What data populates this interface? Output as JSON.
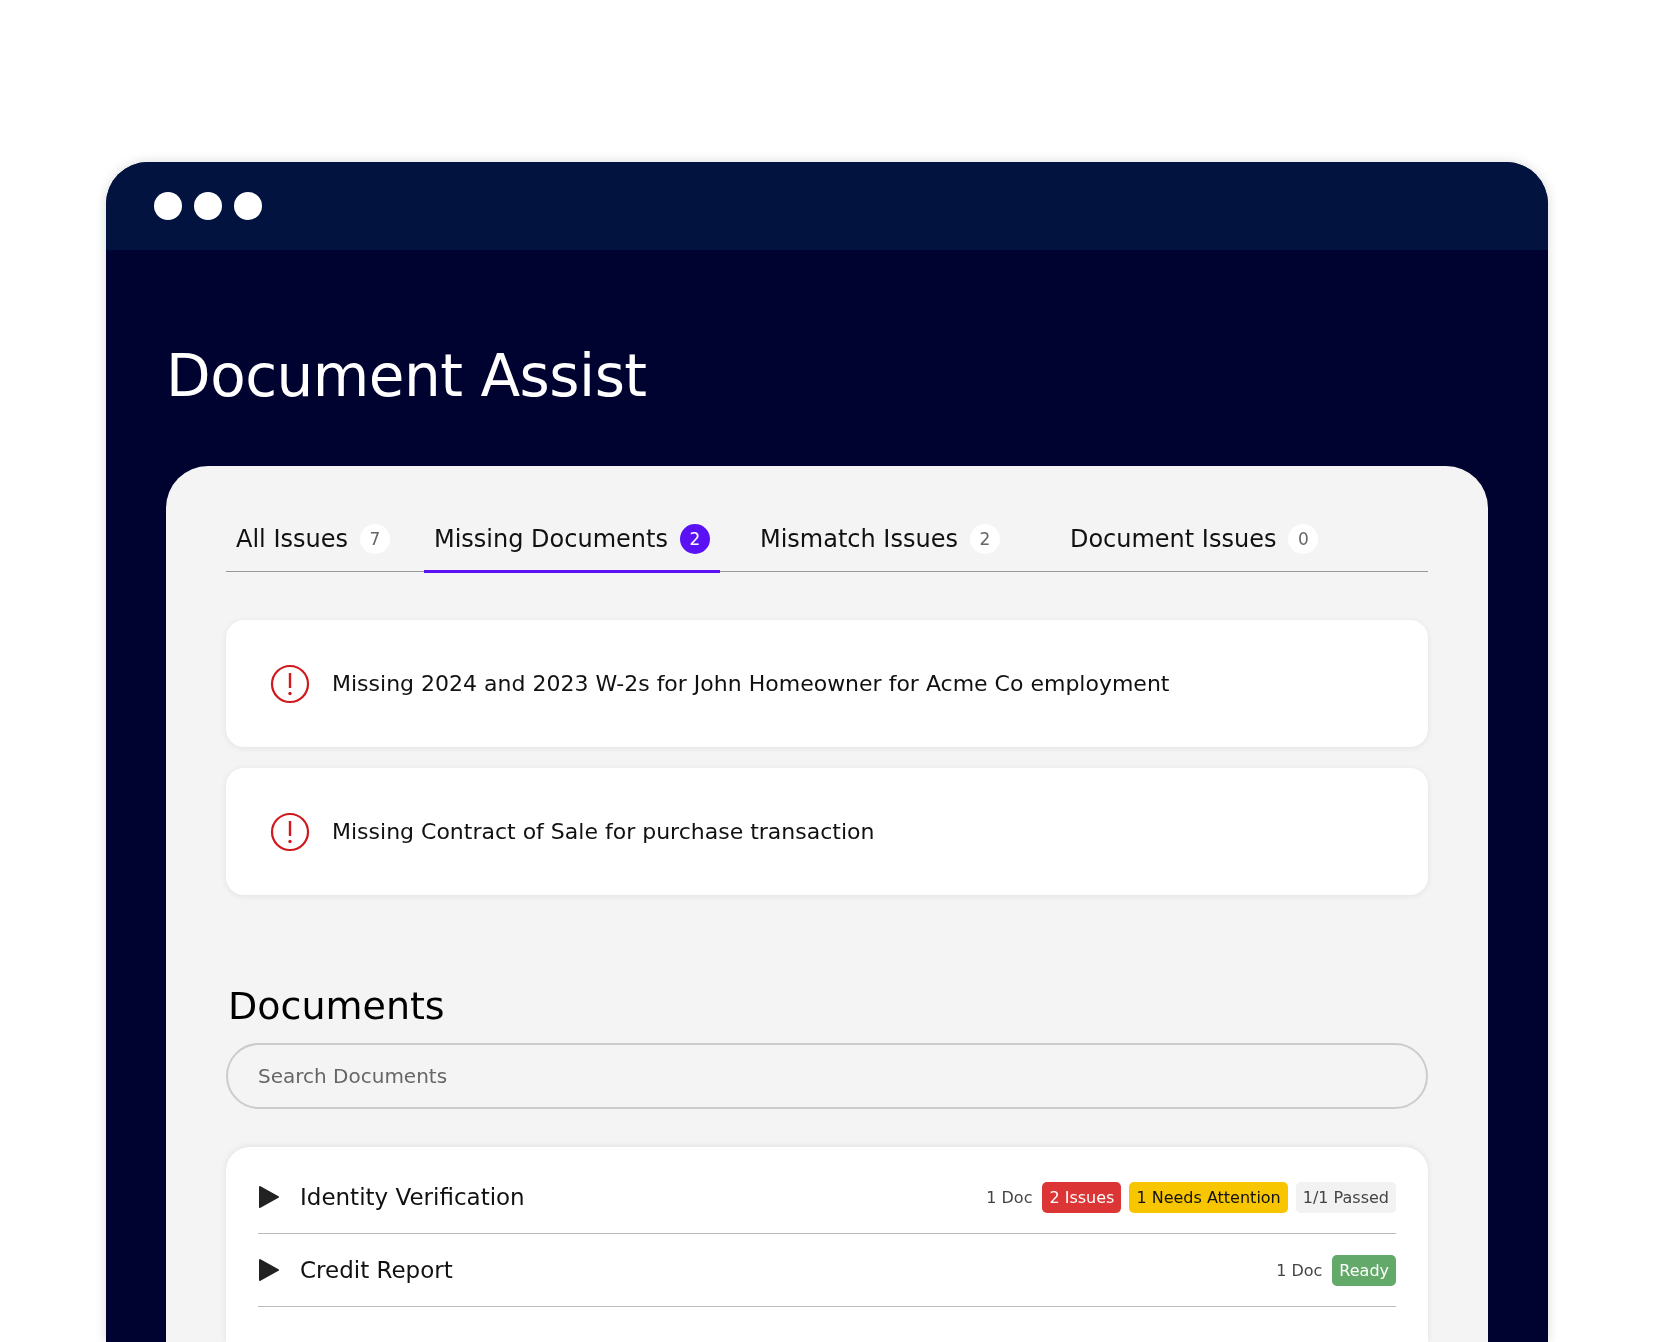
{
  "window": {
    "title": "Document Assist"
  },
  "tabs": [
    {
      "label": "All Issues",
      "count": "7",
      "selected": false
    },
    {
      "label": "Missing Documents",
      "count": "2",
      "selected": true
    },
    {
      "label": "Mismatch Issues",
      "count": "2",
      "selected": false
    },
    {
      "label": "Document Issues",
      "count": "0",
      "selected": false
    }
  ],
  "alerts": [
    {
      "text": "Missing 2024 and 2023 W-2s for John Homeowner for Acme Co employment"
    },
    {
      "text": "Missing Contract of Sale for purchase transaction"
    }
  ],
  "documents": {
    "title": "Documents",
    "search": {
      "placeholder": "Search Documents"
    },
    "rows": [
      {
        "name": "Identity Verification",
        "doc_count": "1 Doc",
        "expanded": false,
        "badges": [
          {
            "kind": "issues",
            "label": "2 Issues"
          },
          {
            "kind": "attention",
            "label": "1 Needs Attention"
          },
          {
            "kind": "passed",
            "label": "1/1 Passed"
          }
        ]
      },
      {
        "name": "Credit Report",
        "doc_count": "1 Doc",
        "expanded": false,
        "badges": [
          {
            "kind": "ready",
            "label": "Ready"
          }
        ]
      }
    ]
  }
}
